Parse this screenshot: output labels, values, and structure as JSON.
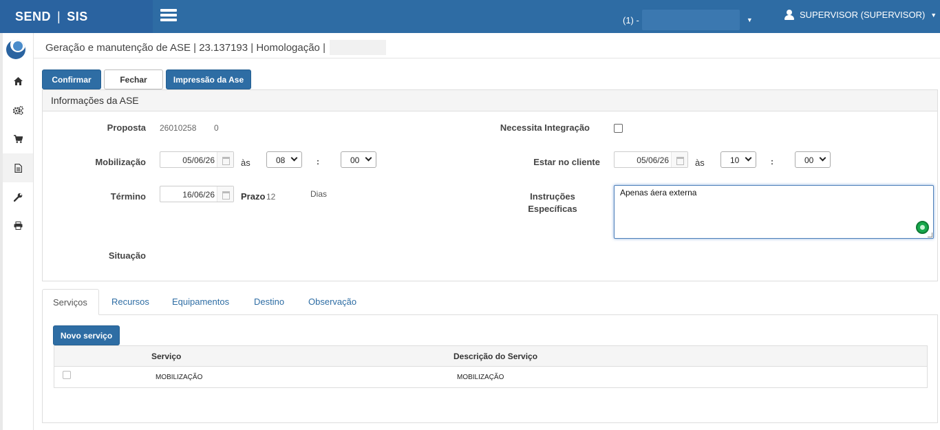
{
  "header": {
    "brand_left": "SEND",
    "brand_sep": "|",
    "brand_right": "SIS",
    "company_prefix": "(1) -",
    "user_label": "SUPERVISOR (SUPERVISOR)"
  },
  "sidebar": {
    "items": [
      {
        "icon": "home-icon",
        "glyph": "⌂"
      },
      {
        "icon": "gears-icon",
        "glyph": "⚙"
      },
      {
        "icon": "cart-icon",
        "glyph": "🛒"
      },
      {
        "icon": "document-icon",
        "glyph": "🗎"
      },
      {
        "icon": "wrench-icon",
        "glyph": "🔧"
      },
      {
        "icon": "print-icon",
        "glyph": "🖶"
      }
    ]
  },
  "page": {
    "title": "Geração e manutenção de ASE | 23.137193 | Homologação |"
  },
  "toolbar": {
    "confirm": "Confirmar",
    "close": "Fechar",
    "print": "Impressão da Ase"
  },
  "panel": {
    "heading": "Informações da ASE",
    "proposta_label": "Proposta",
    "proposta_value": "26010258",
    "proposta_extra": "0",
    "mobilizacao_label": "Mobilização",
    "mobilizacao_date": "05/06/26",
    "as_label": "às",
    "mob_hour": "08",
    "colon": ":",
    "mob_min": "00",
    "termino_label": "Término",
    "termino_date": "16/06/26",
    "prazo_label": "Prazo",
    "prazo_value": "12",
    "dias_label": "Dias",
    "situacao_label": "Situação",
    "integracao_label": "Necessita Integração",
    "integracao_checked": false,
    "cliente_label": "Estar no cliente",
    "cliente_date": "05/06/26",
    "cli_hour": "10",
    "cli_min": "00",
    "instrucoes_label_1": "Instruções",
    "instrucoes_label_2": "Específicas",
    "instrucoes_value": "Apenas áera externa"
  },
  "tabs": [
    "Serviços",
    "Recursos",
    "Equipamentos",
    "Destino",
    "Observação"
  ],
  "servicos": {
    "new_button": "Novo serviço",
    "columns": [
      "Serviço",
      "Descrição do Serviço"
    ],
    "rows": [
      {
        "servico": "MOBILIZAÇÃO",
        "descricao": "MOBILIZAÇÃO"
      }
    ]
  }
}
